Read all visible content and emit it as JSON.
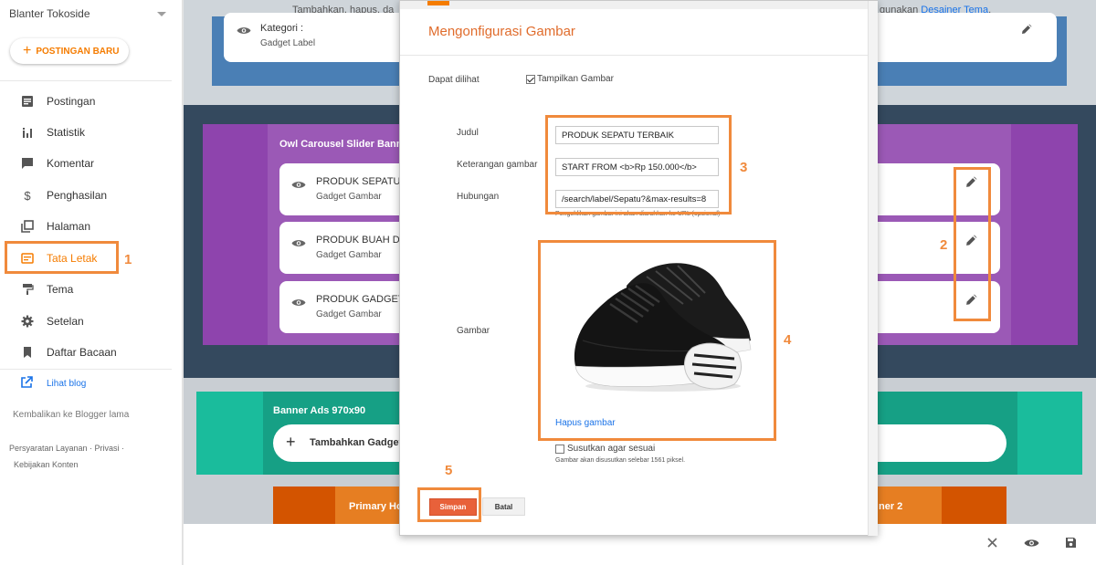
{
  "sidebar": {
    "blog_name": "Blanter Tokoside",
    "new_post_label": "POSTINGAN BARU",
    "items": [
      {
        "label": "Postingan",
        "icon": "posts-icon"
      },
      {
        "label": "Statistik",
        "icon": "stats-icon"
      },
      {
        "label": "Komentar",
        "icon": "comment-icon"
      },
      {
        "label": "Penghasilan",
        "icon": "dollar-icon"
      },
      {
        "label": "Halaman",
        "icon": "pages-icon"
      },
      {
        "label": "Tata Letak",
        "icon": "layout-icon"
      },
      {
        "label": "Tema",
        "icon": "paint-roller-icon"
      },
      {
        "label": "Setelan",
        "icon": "gear-icon"
      },
      {
        "label": "Daftar Bacaan",
        "icon": "bookmark-icon"
      }
    ],
    "view_blog": "Lihat blog",
    "back_old": "Kembalikan ke Blogger lama",
    "footer_line1": "Persyaratan Layanan · Privasi ·",
    "footer_line2": "Kebijakan Konten"
  },
  "annotations": {
    "n1": "1",
    "n2": "2",
    "n3": "3",
    "n4": "4",
    "n5": "5"
  },
  "layout_editor": {
    "top_text_left": "Tambahkan, hapus, da",
    "top_text_right_prefix": "gunakan",
    "top_text_right_link": "Desainer Tema",
    "top_text_right_suffix": ".",
    "header_card": {
      "title": "Kategori :",
      "subtitle": "Gadget Label"
    },
    "purple_section_title": "Owl Carousel Slider Banne",
    "gadget_cards": [
      {
        "title": "PRODUK SEPATU",
        "subtitle": "Gadget Gambar"
      },
      {
        "title": "PRODUK BUAH DA",
        "subtitle": "Gadget Gambar"
      },
      {
        "title": "PRODUK GADGET",
        "subtitle": "Gadget Gambar"
      }
    ],
    "banner_section_title": "Banner Ads 970x90",
    "add_gadget_label": "Tambahkan Gadget",
    "primary_left": "Primary Ho",
    "primary_right": "ner 2"
  },
  "dialog": {
    "title": "Mengonfigurasi Gambar",
    "visible_label": "Dapat dilihat",
    "show_image_label": "Tampilkan Gambar",
    "show_image_checked": true,
    "title_label": "Judul",
    "title_value": "PRODUK SEPATU TERBAIK",
    "caption_label": "Keterangan gambar",
    "caption_value": "START FROM <b>Rp 150.000</b>",
    "link_label": "Hubungan",
    "link_value": "/search/label/Sepatu?&max-results=8",
    "link_hint": "Pengeklikan gambar ini akan diarahkan ke URL (opsional)",
    "image_label": "Gambar",
    "remove_image": "Hapus gambar",
    "shrink_label": "Susutkan agar sesuai",
    "shrink_checked": false,
    "shrink_hint": "Gambar akan disusutkan selebar 1561 piksel.",
    "save_label": "Simpan",
    "cancel_label": "Batal"
  },
  "colors": {
    "accent": "#f57c00",
    "annotation": "#f08a3c",
    "header_blue": "#4a7fb5",
    "dark_slate": "#34495e",
    "purple": "#8e44ad",
    "teal": "#1abc9c",
    "orange_dark": "#d35400"
  }
}
